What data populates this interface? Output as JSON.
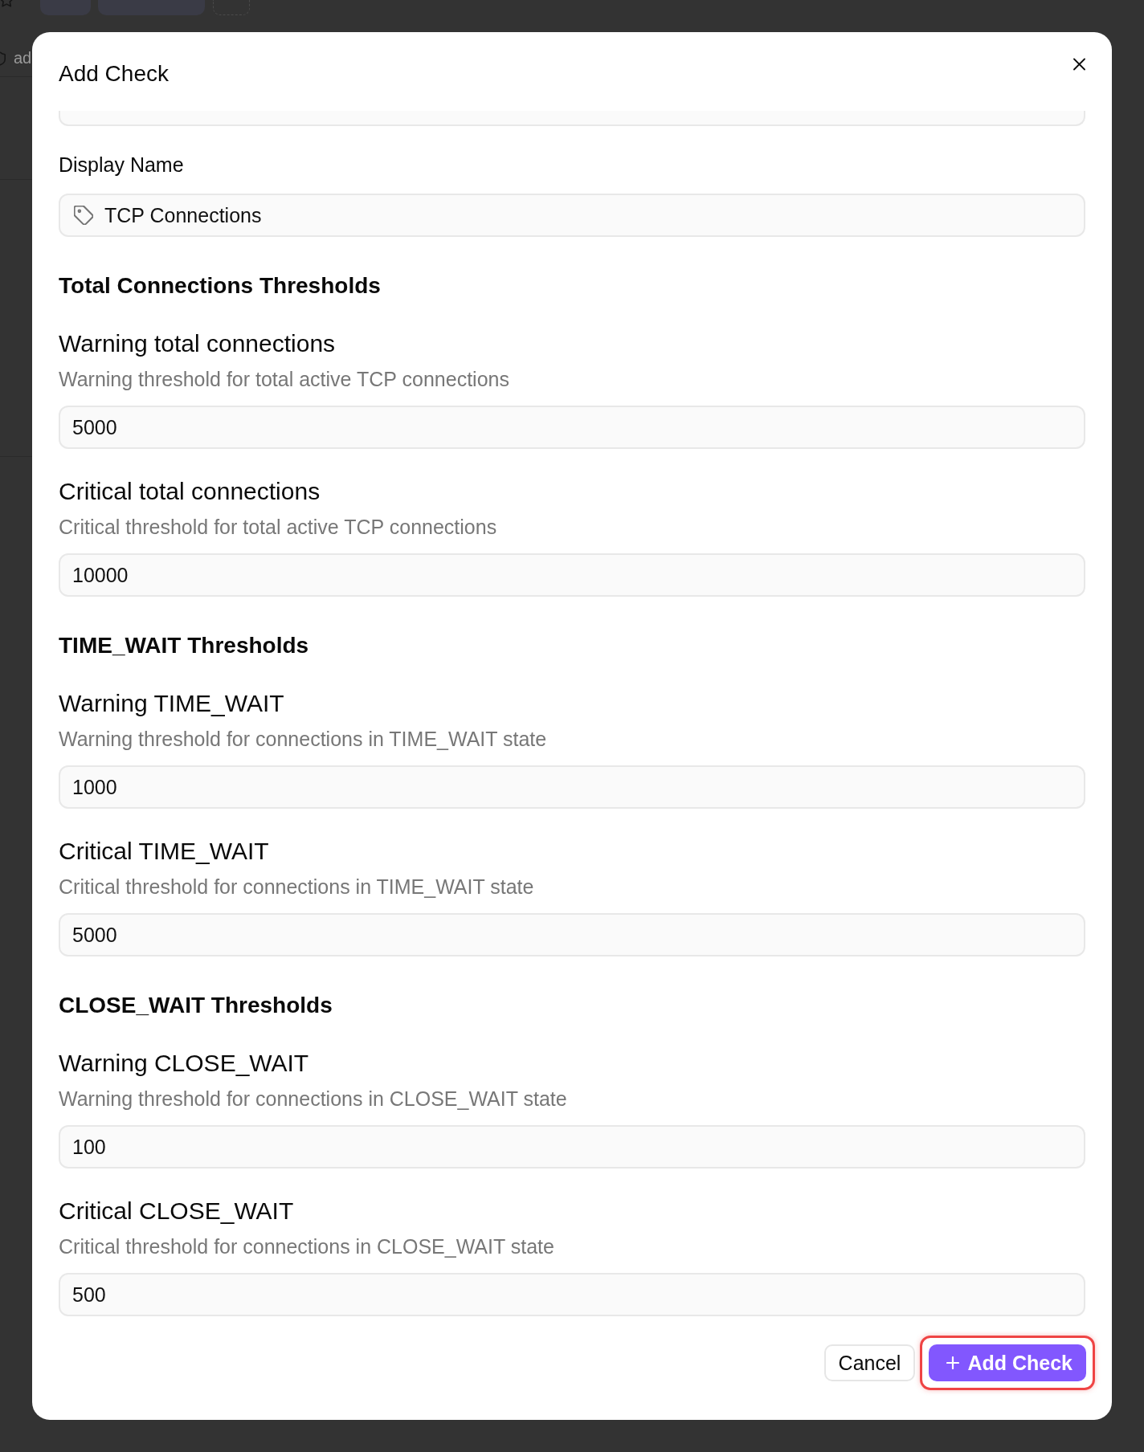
{
  "background": {
    "row_label": "ad"
  },
  "dialog": {
    "title": "Add Check",
    "display_name": {
      "label": "Display Name",
      "value": "TCP Connections"
    },
    "sections": [
      {
        "heading": "Total Connections Thresholds",
        "fields": [
          {
            "label": "Warning total connections",
            "description": "Warning threshold for total active TCP connections",
            "value": "5000"
          },
          {
            "label": "Critical total connections",
            "description": "Critical threshold for total active TCP connections",
            "value": "10000"
          }
        ]
      },
      {
        "heading": "TIME_WAIT Thresholds",
        "fields": [
          {
            "label": "Warning TIME_WAIT",
            "description": "Warning threshold for connections in TIME_WAIT state",
            "value": "1000"
          },
          {
            "label": "Critical TIME_WAIT",
            "description": "Critical threshold for connections in TIME_WAIT state",
            "value": "5000"
          }
        ]
      },
      {
        "heading": "CLOSE_WAIT Thresholds",
        "fields": [
          {
            "label": "Warning CLOSE_WAIT",
            "description": "Warning threshold for connections in CLOSE_WAIT state",
            "value": "100"
          },
          {
            "label": "Critical CLOSE_WAIT",
            "description": "Critical threshold for connections in CLOSE_WAIT state",
            "value": "500"
          }
        ]
      }
    ],
    "buttons": [
      {
        "kind": "secondary",
        "label": "Cancel",
        "highlighted": false
      },
      {
        "kind": "primary",
        "label": "Add Check",
        "highlighted": true
      }
    ]
  }
}
